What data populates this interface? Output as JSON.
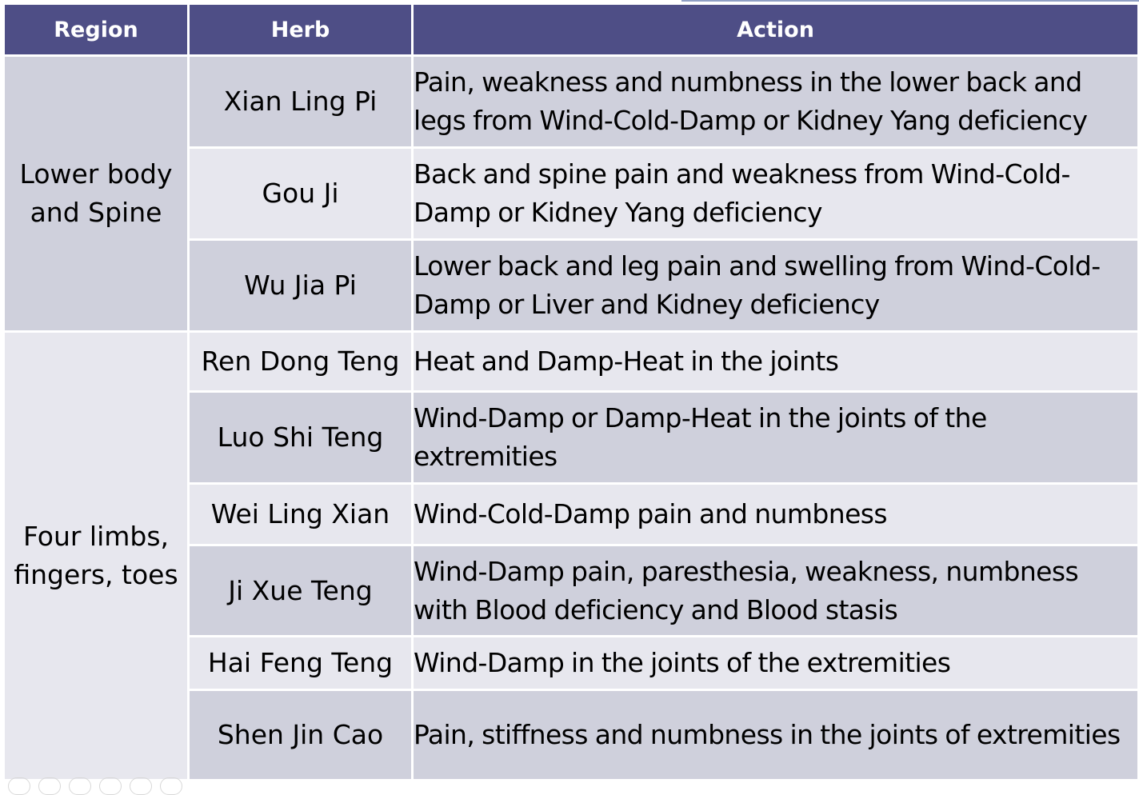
{
  "table": {
    "headers": [
      "Region",
      "Herb",
      "Action"
    ],
    "groups": [
      {
        "region": "Lower body and Spine",
        "rows": [
          {
            "herb": "Xian Ling Pi",
            "action": "Pain, weakness and numbness in the lower back and legs from Wind-Cold-Damp or Kidney Yang deficiency"
          },
          {
            "herb": "Gou Ji",
            "action": "Back and spine pain and weakness from Wind-Cold-Damp or Kidney Yang deficiency"
          },
          {
            "herb": "Wu Jia Pi",
            "action": "Lower back and leg pain and swelling from Wind-Cold-Damp or Liver and Kidney deficiency"
          }
        ]
      },
      {
        "region": "Four limbs, fingers, toes",
        "rows": [
          {
            "herb": "Ren Dong Teng",
            "action": "Heat and Damp-Heat in the joints"
          },
          {
            "herb": "Luo Shi Teng",
            "action": "Wind-Damp or Damp-Heat in the joints of the extremities"
          },
          {
            "herb": "Wei Ling Xian",
            "action": "Wind-Cold-Damp pain and numbness"
          },
          {
            "herb": "Ji Xue Teng",
            "action": "Wind-Damp pain, paresthesia, weakness, numbness with Blood deficiency and Blood stasis"
          },
          {
            "herb": "Hai Feng Teng",
            "action": "Wind-Damp in the joints of the extremities"
          },
          {
            "herb": "Shen Jin Cao",
            "action": "Pain, stiffness and numbness in the joints of extremities"
          }
        ]
      }
    ]
  },
  "colors": {
    "header_bg": "#4e4e86",
    "row_dark": "#cfd0dc",
    "row_light": "#e7e7ee"
  }
}
